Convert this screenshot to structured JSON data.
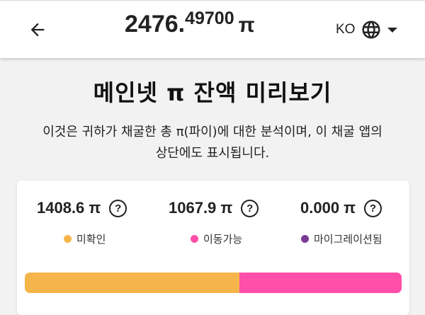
{
  "header": {
    "balance_int": "2476.",
    "balance_dec": "49700",
    "pi_symbol": "π",
    "lang_code": "KO"
  },
  "icons": {
    "back": "arrow-left-icon",
    "globe": "globe-icon",
    "caret": "caret-down-icon",
    "help": "help-circle-icon"
  },
  "main": {
    "title": "메인넷 π 잔액 미리보기",
    "description": "이것은 귀하가 채굴한 총 π(파이)에 대한 분석이며, 이 채굴 앱의 상단에도 표시됩니다."
  },
  "stats": [
    {
      "value": "1408.6 π",
      "label": "미확인",
      "color": "#f5b54a",
      "amount": 1408.6
    },
    {
      "value": "1067.9 π",
      "label": "이동가능",
      "color": "#ff4fa8",
      "amount": 1067.9
    },
    {
      "value": "0.000 π",
      "label": "마이그레이션됨",
      "color": "#7b3a96",
      "amount": 0.0
    }
  ],
  "help_symbol": "?"
}
